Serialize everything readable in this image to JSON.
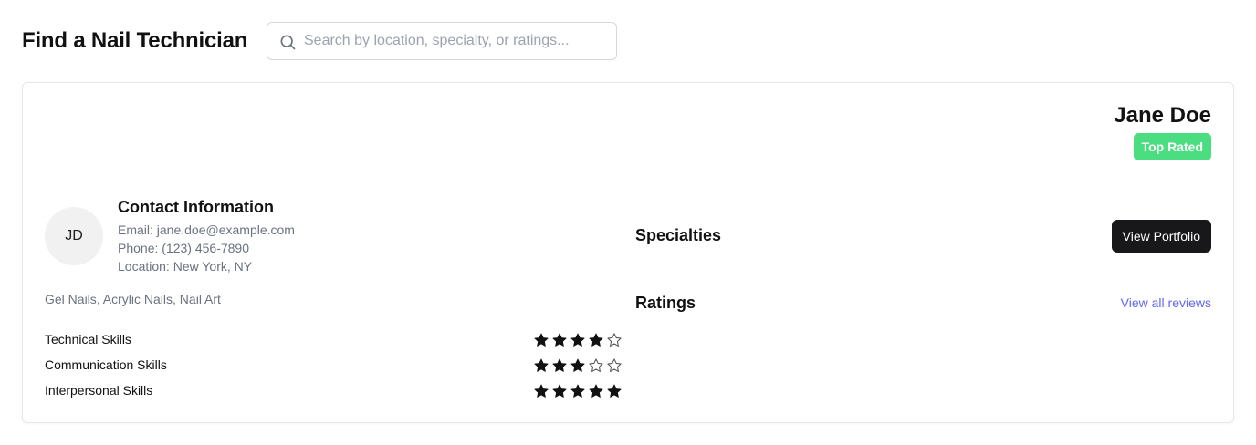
{
  "header": {
    "title": "Find a Nail Technician",
    "search_placeholder": "Search by location, specialty, or ratings...",
    "search_value": ""
  },
  "technician": {
    "name": "Jane Doe",
    "badge": "Top Rated",
    "initials": "JD",
    "contact": {
      "title": "Contact Information",
      "email": "Email: jane.doe@example.com",
      "phone": "Phone: (123) 456-7890",
      "location": "Location: New York, NY"
    },
    "specialties_title": "Specialties",
    "specialties": "Gel Nails, Acrylic Nails, Nail Art",
    "portfolio_button": "View Portfolio",
    "ratings_title": "Ratings",
    "reviews_link": "View all reviews",
    "ratings": [
      {
        "label": "Technical Skills",
        "stars": 4,
        "max": 5
      },
      {
        "label": "Communication Skills",
        "stars": 3,
        "max": 5
      },
      {
        "label": "Interpersonal Skills",
        "stars": 5,
        "max": 5
      }
    ]
  },
  "colors": {
    "badge": "#4ade80",
    "primary_button": "#18181b",
    "link": "#6366f1",
    "muted_text": "#6b7280",
    "star_filled": "#111111",
    "star_empty_stroke": "#555555"
  },
  "icons": {
    "search": "search-icon",
    "star_filled": "star-filled-icon",
    "star_empty": "star-empty-icon"
  }
}
